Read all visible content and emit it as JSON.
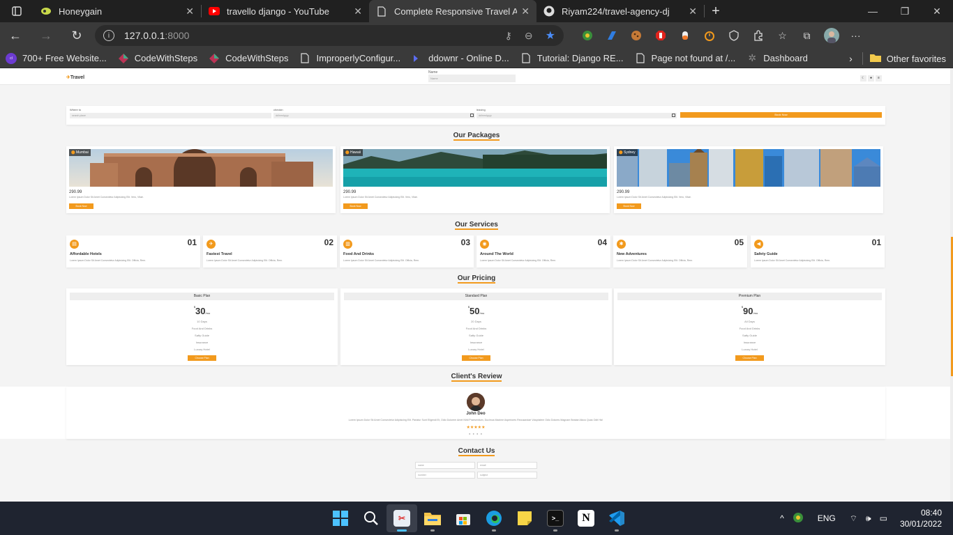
{
  "browser": {
    "tabs": [
      {
        "title": "Honeygain",
        "icon": "honeygain-icon"
      },
      {
        "title": "travello django - YouTube",
        "icon": "youtube-icon"
      },
      {
        "title": "Complete Responsive Travel Age",
        "icon": "document-icon"
      },
      {
        "title": "Riyam224/travel-agency-dj",
        "icon": "github-icon"
      }
    ],
    "url": "127.0.0.1",
    "url_port": ":8000",
    "bookmarks": [
      {
        "label": "700+ Free Website...",
        "icon": "colorlib-icon"
      },
      {
        "label": "CodeWithSteps",
        "icon": "diamond-icon"
      },
      {
        "label": "CodeWithSteps",
        "icon": "diamond-icon"
      },
      {
        "label": "ImproperlyConfigur...",
        "icon": "page-icon"
      },
      {
        "label": "ddownr - Online D...",
        "icon": "ddownr-icon"
      },
      {
        "label": "Tutorial: Django RE...",
        "icon": "page-icon"
      },
      {
        "label": "Page not found at /...",
        "icon": "page-icon"
      },
      {
        "label": "Dashboard",
        "icon": "gear-icon"
      }
    ],
    "other_favorites": "Other favorites"
  },
  "site": {
    "logo": "Travel",
    "header_name_label": "Name",
    "header_name_placeholder": "Name",
    "booking": {
      "where_label": "Where to",
      "where_placeholder": "search place",
      "checkin_label": "checkin",
      "checkin_placeholder": "dd/mm/yyyy",
      "leaving_label": "leaving",
      "leaving_placeholder": "dd/mm/yyyy",
      "button": "Book Now"
    },
    "packages_title_pre": "Our ",
    "packages_title_hl": "Packages",
    "packages": [
      {
        "location": "Mumbai",
        "price": "290.99",
        "desc": "Lorem Ipsum Dolor Sit Amet Consectetur Adipisicing Elit. Vero, Vitae.",
        "button": "Book Now"
      },
      {
        "location": "Hawaii",
        "price": "290.99",
        "desc": "Lorem Ipsum Dolor Sit Amet Consectetur Adipisicing Elit. Vero, Vitae.",
        "button": "Book Now"
      },
      {
        "location": "Sydney",
        "price": "290.99",
        "desc": "Lorem Ipsum Dolor Sit Amet Consectetur Adipisicing Elit. Vero, Vitae.",
        "button": "Book Now"
      }
    ],
    "services_title_pre": "Our ",
    "services_title_hl": "Services",
    "services": [
      {
        "num": "01",
        "name": "Affordable Hotels",
        "icon": "hotel-icon",
        "desc": "Lorem Ipsum Dolor Sit Amet Consectetur Adipisicing Elit. Officia, Rem."
      },
      {
        "num": "02",
        "name": "Fastest Travel",
        "icon": "plane-icon",
        "desc": "Lorem Ipsum Dolor Sit Amet Consectetur Adipisicing Elit. Officia, Rem."
      },
      {
        "num": "03",
        "name": "Food And Drinks",
        "icon": "food-icon",
        "desc": "Lorem Ipsum Dolor Sit Amet Consectetur Adipisicing Elit. Officia, Rem."
      },
      {
        "num": "04",
        "name": "Around The World",
        "icon": "globe-icon",
        "desc": "Lorem Ipsum Dolor Sit Amet Consectetur Adipisicing Elit. Officia, Rem."
      },
      {
        "num": "05",
        "name": "New Adventures",
        "icon": "hiking-icon",
        "desc": "Lorem Ipsum Dolor Sit Amet Consectetur Adipisicing Elit. Officia, Rem."
      },
      {
        "num": "01",
        "name": "Safety Guide",
        "icon": "bullhorn-icon",
        "desc": "Lorem Ipsum Dolor Sit Amet Consectetur Adipisicing Elit. Officia, Rem."
      }
    ],
    "pricing_title_pre": "Our ",
    "pricing_title_hl": "Pricing",
    "plans": [
      {
        "name": "Basic Plan",
        "currency": "$",
        "amount": "30",
        "period": "/mo",
        "features": [
          "10 Days",
          "Food And Drinks",
          "Safty Guide",
          "Insurance",
          "Luxury Hotel"
        ],
        "button": "Choose Plan"
      },
      {
        "name": "Standard Plan",
        "currency": "$",
        "amount": "50",
        "period": "/mo",
        "features": [
          "20 Days",
          "Food And Drinks",
          "Safty Guide",
          "Insurance",
          "Luxury Hotel"
        ],
        "button": "Choose Plan"
      },
      {
        "name": "Premium Plan",
        "currency": "$",
        "amount": "90",
        "period": "/mo",
        "features": [
          "All Days",
          "Food And Drinks",
          "Safty Guide",
          "Insurance",
          "Luxury Hotel"
        ],
        "button": "Choose Plan"
      }
    ],
    "review_title_pre": "Client's ",
    "review_title_hl": "Review",
    "review": {
      "name": "John Deo",
      "text": "Lorem Ipsum Dolor Sit Amet Consectetur Adipisicing Elit. Pariatur Sunt Eligendi Et, Odio Dolorem Amet Nihil Praesentium, Ducimus Maxime Asperiores Recusandae Voluptatem Odio Dolores Magnam Beatae Alicus Quas Odit Hic!",
      "stars": "★★★★★",
      "rating": 5
    },
    "contact_title_pre": "Contact ",
    "contact_title_hl": "Us",
    "contact": {
      "name_placeholder": "name",
      "email_placeholder": "email",
      "number_placeholder": "number",
      "subject_placeholder": "subject"
    },
    "accent": "#f29a1d"
  },
  "taskbar": {
    "lang": "ENG",
    "time": "08:40",
    "date": "30/01/2022"
  }
}
